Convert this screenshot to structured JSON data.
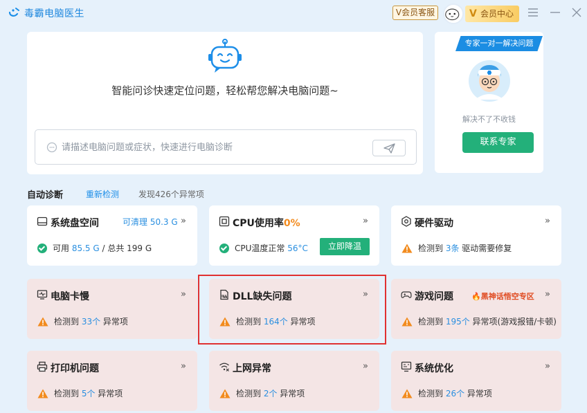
{
  "app": {
    "title": "毒霸电脑医生"
  },
  "header": {
    "vip_service": "V会员客服",
    "vip_center": "会员中心",
    "vip_center_v": "V"
  },
  "diagnose": {
    "tagline": "智能问诊快速定位问题，轻松帮您解决电脑问题~",
    "search_placeholder": "请描述电脑问题或症状，快速进行电脑诊断"
  },
  "expert": {
    "banner": "专家一对一解决问题",
    "slogan": "解决不了不收钱",
    "button": "联系专家"
  },
  "auto": {
    "title": "自动诊断",
    "redetect": "重新检测",
    "found": "发现426个异常项"
  },
  "tiles": {
    "disk": {
      "title": "系统盘空间",
      "cleanable": "可清理 50.3 G",
      "avail_prefix": "可用 ",
      "avail_value": "85.5 G",
      "total": " / 总共 199 G"
    },
    "cpu": {
      "title": "CPU使用率",
      "usage": "0%",
      "temp_label": "CPU温度正常 ",
      "temp_value": "56°C",
      "button": "立即降温"
    },
    "driver": {
      "title": "硬件驱动",
      "prefix": "检测到 ",
      "count": "3条",
      "suffix": " 驱动需要修复"
    },
    "slow": {
      "title": "电脑卡慢",
      "prefix": "检测到 ",
      "count": "33个",
      "suffix": " 异常项"
    },
    "dll": {
      "title": "DLL缺失问题",
      "prefix": "检测到 ",
      "count": "164个",
      "suffix": " 异常项"
    },
    "game": {
      "title": "游戏问题",
      "hot": "黑神话悟空专区",
      "prefix": "检测到 ",
      "count": "195个",
      "suffix": " 异常项(游戏报错/卡顿)"
    },
    "printer": {
      "title": "打印机问题",
      "prefix": "检测到 ",
      "count": "5个",
      "suffix": " 异常项"
    },
    "network": {
      "title": "上网异常",
      "prefix": "检测到 ",
      "count": "2个",
      "suffix": " 异常项"
    },
    "optimize": {
      "title": "系统优化",
      "prefix": "检测到 ",
      "count": "26个",
      "suffix": " 异常项"
    }
  },
  "icons": [
    "app-logo-icon",
    "avatar-icon",
    "menu-icon",
    "minimize-icon",
    "close-icon",
    "robot-icon",
    "chat-icon",
    "send-icon",
    "doctor-icon",
    "disk-icon",
    "cpu-icon",
    "chip-icon",
    "monitor-icon",
    "dll-icon",
    "gamepad-icon",
    "fire-icon",
    "printer-icon",
    "wifi-icon",
    "optimize-icon",
    "check-icon",
    "warning-icon",
    "chevron-right-icon"
  ],
  "colors": {
    "accent": "#1d8ee8",
    "green": "#23b07a",
    "orange": "#f28b1e",
    "warn_tile": "#f4e5e5",
    "highlight": "#e03131"
  }
}
